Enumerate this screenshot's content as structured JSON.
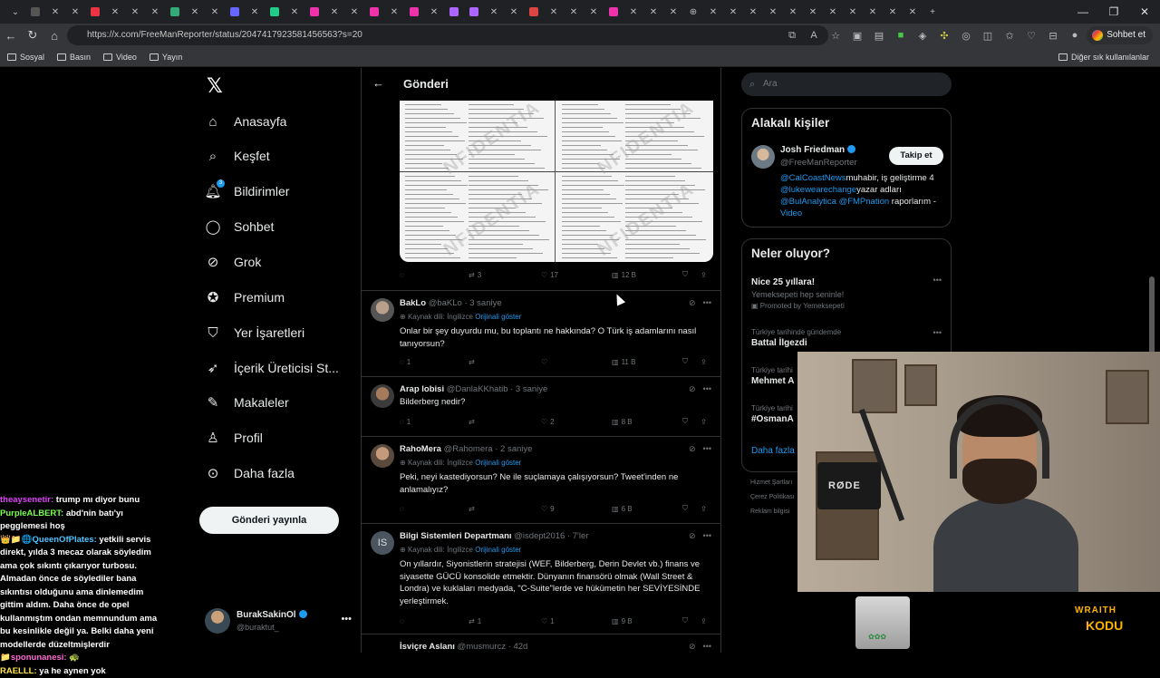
{
  "browser": {
    "url": "https://x.com/FreeManReporter/status/2047417923581456563?s=20",
    "chat_button": "Sohbet et",
    "bookmarks": [
      "Sosyal",
      "Basın",
      "Video",
      "Yayın"
    ],
    "other_bookmarks": "Diğer sık kullanılanlar"
  },
  "nav": {
    "items": [
      {
        "label": "Anasayfa",
        "icon": "home-icon"
      },
      {
        "label": "Keşfet",
        "icon": "search-icon"
      },
      {
        "label": "Bildirimler",
        "icon": "bell-icon"
      },
      {
        "label": "Sohbet",
        "icon": "chat-icon"
      },
      {
        "label": "Grok",
        "icon": "grok-icon"
      },
      {
        "label": "Premium",
        "icon": "premium-icon"
      },
      {
        "label": "Yer İşaretleri",
        "icon": "bookmark-icon"
      },
      {
        "label": "İçerik Üreticisi St...",
        "icon": "rocket-icon"
      },
      {
        "label": "Makaleler",
        "icon": "article-icon"
      },
      {
        "label": "Profil",
        "icon": "person-icon"
      },
      {
        "label": "Daha fazla",
        "icon": "more-icon"
      }
    ],
    "notif_count": "3",
    "post_button": "Gönderi yayınla",
    "me_name": "BurakSakinOl",
    "me_handle": "@buraktut_"
  },
  "feed": {
    "header": "Gönderi",
    "main_stats": {
      "replies": "",
      "reposts": "3",
      "likes": "17",
      "views": "12 B"
    },
    "tweets": [
      {
        "name": "BakLo",
        "handle": "@baKLo",
        "time": "· 3 saniye",
        "source": "Kaynak dili: İngilizce",
        "show_original": "Orijinali göster",
        "text": "Onlar bir şey duyurdu mu, bu toplantı ne hakkında? O Türk iş adamlarını nasıl tanıyorsun?",
        "replies": "1",
        "reposts": "",
        "likes": "",
        "views": "11 B"
      },
      {
        "name": "Arap lobisi",
        "handle": "@DanlaKKhatib",
        "time": "· 3 saniye",
        "text": "Bilderberg nedir?",
        "replies": "1",
        "reposts": "",
        "likes": "2",
        "views": "8 B"
      },
      {
        "name": "RahoMera",
        "handle": "@Rahomera",
        "time": "· 2 saniye",
        "source": "Kaynak dili: İngilizce",
        "show_original": "Orijinali göster",
        "text": "Peki, neyi kastediyorsun? Ne ile suçlamaya çalışıyorsun? Tweet'inden ne anlamalıyız?",
        "replies": "",
        "reposts": "",
        "likes": "9",
        "views": "6 B"
      },
      {
        "name": "Bilgi Sistemleri Departmanı",
        "handle": "@isdept2016",
        "time": "· 7'ler",
        "source": "Kaynak dili: İngilizce",
        "show_original": "Orijinali göster",
        "text": "On yıllardır, Siyonistlerin stratejisi (WEF, Bilderberg, Derin Devlet vb.) finans ve siyasette GÜCÜ konsolide etmektir. Dünyanın finansörü olmak (Wall Street & Londra) ve kuklaları medyada, \"C-Suite\"lerde ve hükümetin her SEVİYESİNDE yerleştirmek.",
        "replies": "",
        "reposts": "1",
        "likes": "1",
        "views": "9 B",
        "avatar_text": "IS"
      },
      {
        "name": "İsviçre Aslanı",
        "handle": "@musmurcz",
        "time": "· 42d"
      }
    ]
  },
  "right": {
    "search_placeholder": "Ara",
    "related_title": "Alakalı kişiler",
    "person_name": "Josh Friedman",
    "person_handle": "@FreeManReporter",
    "follow": "Takip et",
    "bio_parts": [
      "@CalCoastNews",
      "muhabir, iş geliştirme 4 ",
      "@lukewearechange",
      "yazar adları ",
      "@BulAnalytica",
      " ",
      "@FMPnation",
      " raporlarım - ",
      "Video"
    ],
    "trends_title": "Neler oluyor?",
    "trends": [
      {
        "context": "",
        "title": "Nice 25 yıllara!",
        "sub": "Yemeksepeti hep seninle!",
        "promo": "Promoted by Yemeksepeti"
      },
      {
        "context": "Türkiye tarihinde gündemde",
        "title": "Battal İlgezdi"
      },
      {
        "context": "Türkiye tarihi",
        "title": "Mehmet A"
      },
      {
        "context": "Türkiye tarihi",
        "title": "#OsmanA"
      }
    ],
    "more": "Daha fazla",
    "footer": [
      "Hizmet Şartları",
      "Çerez Politikası",
      "Reklam bilgisi"
    ]
  },
  "chat": [
    {
      "user": "theaysenetir:",
      "msg": "trump mı diyor bunu"
    },
    {
      "user": "PurpleALBERT:",
      "msg": "abd'nin batı'yı pegglemesi hoş"
    },
    {
      "user": "QueenOfPlates:",
      "msg": "yetkili servis direkt, yılda 3 mecaz olarak söyledim ama çok sıkıntı çıkarıyor turbosu. Almadan önce de söylediler bana sıkıntısı olduğunu ama dinlemedim gittim aldım. Daha önce de opel kullanmıştım ondan memnundum ama bu kesinlikle değil ya. Belki daha yeni modellerde düzeltmişlerdir"
    },
    {
      "user": "sponunanesi:",
      "msg": ""
    },
    {
      "user": "RAELLL:",
      "msg": "ya he aynen yok"
    }
  ],
  "overlay": {
    "mic_brand": "RØDE",
    "logo_line1": "WRAITH",
    "logo_line2": "KODU"
  }
}
